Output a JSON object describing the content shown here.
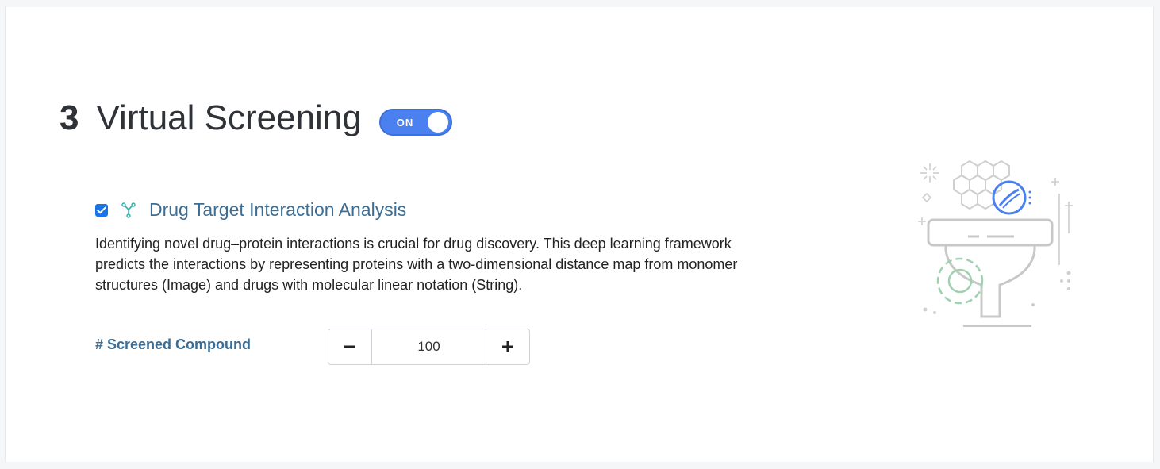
{
  "section": {
    "number": "3",
    "title": "Virtual Screening",
    "toggle_label": "ON",
    "toggle_state": "on"
  },
  "option": {
    "checked": true,
    "icon": "molecule-icon",
    "title": "Drug Target Interaction Analysis",
    "description": "Identifying novel drug–protein interactions is crucial for drug discovery. This deep learning framework predicts the interactions by representing proteins with a two-dimensional distance map from monomer structures (Image) and drugs with molecular linear notation (String)."
  },
  "parameter": {
    "label": "# Screened Compound",
    "value": "100",
    "minus_icon": "minus-icon",
    "plus_icon": "plus-icon"
  },
  "illustration": {
    "icon": "screening-funnel-illustration",
    "accent_color": "#4a80f0",
    "gear_color": "#9fd1b0",
    "line_color": "#c8c8c8"
  },
  "colors": {
    "toggle": "#4a80f0",
    "title_blue": "#3d6d92",
    "checkbox": "#1a73e8"
  }
}
